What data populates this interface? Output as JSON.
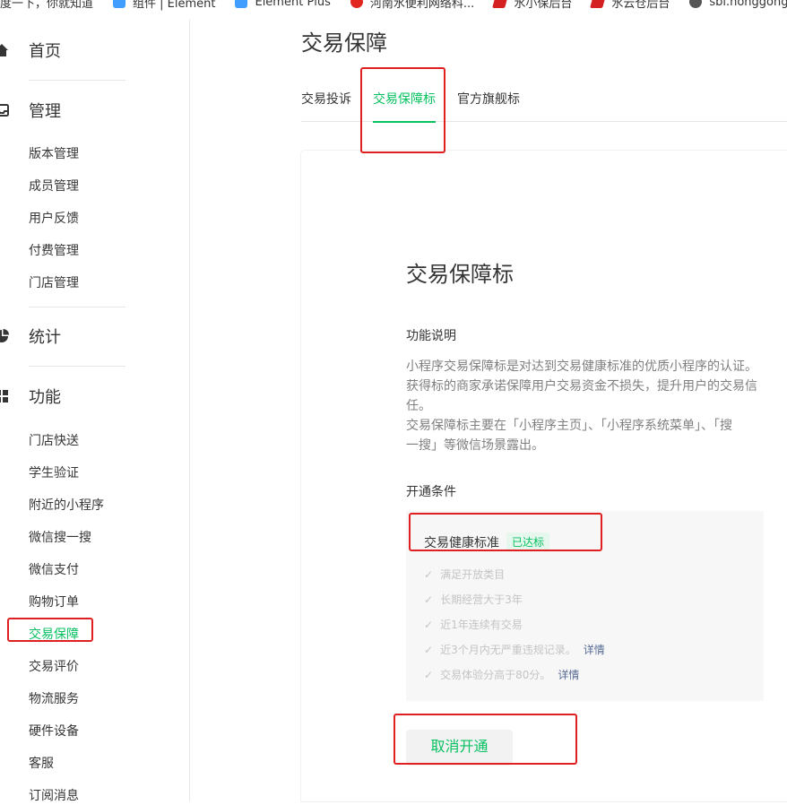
{
  "bookmarks": [
    {
      "label": "度一下，你就知道",
      "icon": "none"
    },
    {
      "label": "组件 | Element",
      "icon": "element-icon"
    },
    {
      "label": "Element Plus",
      "icon": "element-icon"
    },
    {
      "label": "河南水便利网络科...",
      "icon": "site-icon"
    },
    {
      "label": "水小保后台",
      "icon": "flag-icon"
    },
    {
      "label": "水云仓后台",
      "icon": "flag-icon"
    },
    {
      "label": "sbl.nonggongcha...",
      "icon": "globe-icon"
    }
  ],
  "sidebar": {
    "home": "首页",
    "manage": "管理",
    "manage_items": [
      "版本管理",
      "成员管理",
      "用户反馈",
      "付费管理",
      "门店管理"
    ],
    "stats": "统计",
    "features": "功能",
    "feature_items": [
      "门店快送",
      "学生验证",
      "附近的小程序",
      "微信搜一搜",
      "微信支付",
      "购物订单",
      "交易保障",
      "交易评价",
      "物流服务",
      "硬件设备",
      "客服",
      "订阅消息"
    ],
    "active_item": "交易保障"
  },
  "main": {
    "title": "交易保障",
    "tabs": [
      "交易投诉",
      "交易保障标",
      "官方旗舰标"
    ],
    "active_tab": "交易保障标",
    "card": {
      "title": "交易保障标",
      "func_label": "功能说明",
      "desc_lines": [
        "小程序交易保障标是对达到交易健康标准的优质小程序的认证。",
        "获得标的商家承诺保障用户交易资金不损失，提升用户的交易信",
        "任。",
        "交易保障标主要在「小程序主页」、「小程序系统菜单」、「搜",
        "一搜」等微信场景露出。"
      ],
      "cond_label": "开通条件",
      "cond_head": "交易健康标准",
      "cond_badge": "已达标",
      "conditions": [
        {
          "text": "满足开放类目",
          "link": ""
        },
        {
          "text": "长期经营大于3年",
          "link": ""
        },
        {
          "text": "近1年连续有交易",
          "link": ""
        },
        {
          "text": "近3个月内无严重违规记录。",
          "link": "详情"
        },
        {
          "text": "交易体验分高于80分。",
          "link": "详情"
        }
      ],
      "cancel_button": "取消开通"
    }
  },
  "colors": {
    "accent": "#07c160",
    "annotation": "#e02020",
    "link": "#576b95"
  }
}
